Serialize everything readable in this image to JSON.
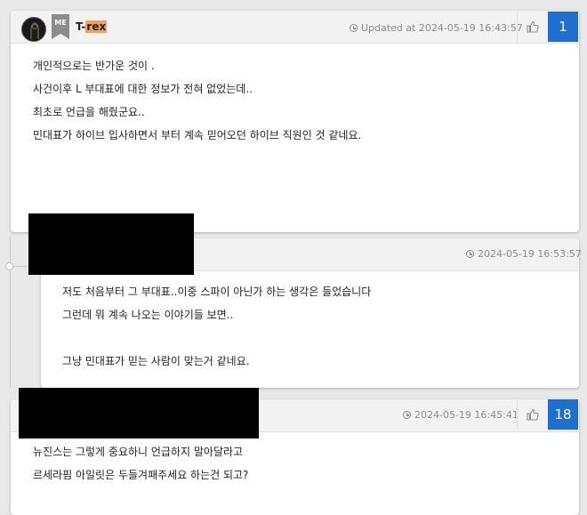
{
  "post1": {
    "username_prefix": "T-",
    "username_highlight": "rex",
    "badge": "ME",
    "timestamp": "Updated at 2024-05-19 16:43:57",
    "count": "1",
    "lines": [
      "개인적으로는 반가운 것이 .",
      "사건이후 L 부대표에 대한 정보가 전혀 없었는데..",
      "최초로 언급을 해줬군요..",
      "민대표가 하이브 입사하면서 부터 계속 믿어오던 하이브 직원인 것 같네요."
    ]
  },
  "reply1": {
    "timestamp": "2024-05-19 16:53:57",
    "lines": [
      "저도 처음부터 그 부대표..이중 스파이 아닌가 하는 생각은 들었습니다",
      "그런데 뭐 계속 나오는 이야기들 보면..",
      "",
      "그냥 민대표가 믿는 사람이 맞는거 같네요."
    ]
  },
  "post2": {
    "timestamp": "2024-05-19 16:45:41",
    "count": "18",
    "lines": [
      "뉴진스는 그렇게 중요하니 언급하지 말아달라고",
      "르세라핌 아일릿은 두들겨패주세요 하는건 되고?"
    ]
  },
  "icons": {
    "clock": "clock-icon",
    "like": "thumbs-up-icon",
    "avatar": "avatar-icon"
  },
  "colors": {
    "accent": "#1f6fd1",
    "highlight": "#f0a060",
    "redaction": "#000000"
  }
}
